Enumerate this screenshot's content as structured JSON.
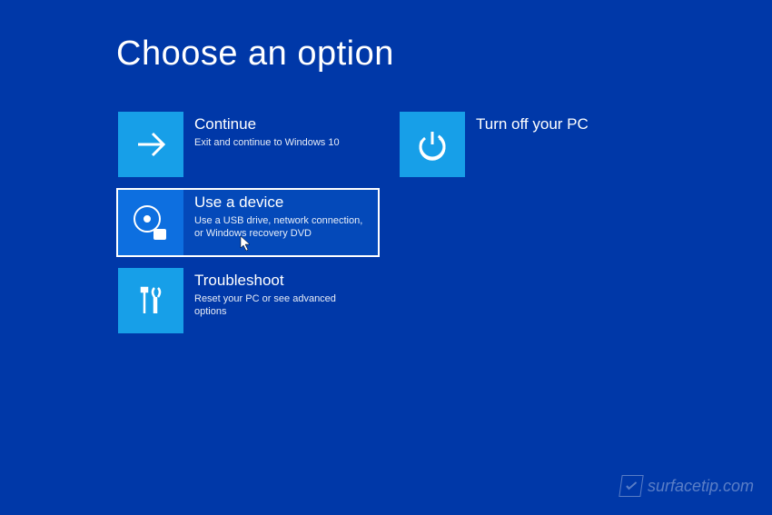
{
  "title": "Choose an option",
  "options": {
    "continue": {
      "title": "Continue",
      "description": "Exit and continue to Windows 10"
    },
    "use_device": {
      "title": "Use a device",
      "description": "Use a USB drive, network connection, or Windows recovery DVD"
    },
    "troubleshoot": {
      "title": "Troubleshoot",
      "description": "Reset your PC or see advanced options"
    },
    "turn_off": {
      "title": "Turn off your PC",
      "description": ""
    }
  },
  "watermark": "surfacetip.com"
}
